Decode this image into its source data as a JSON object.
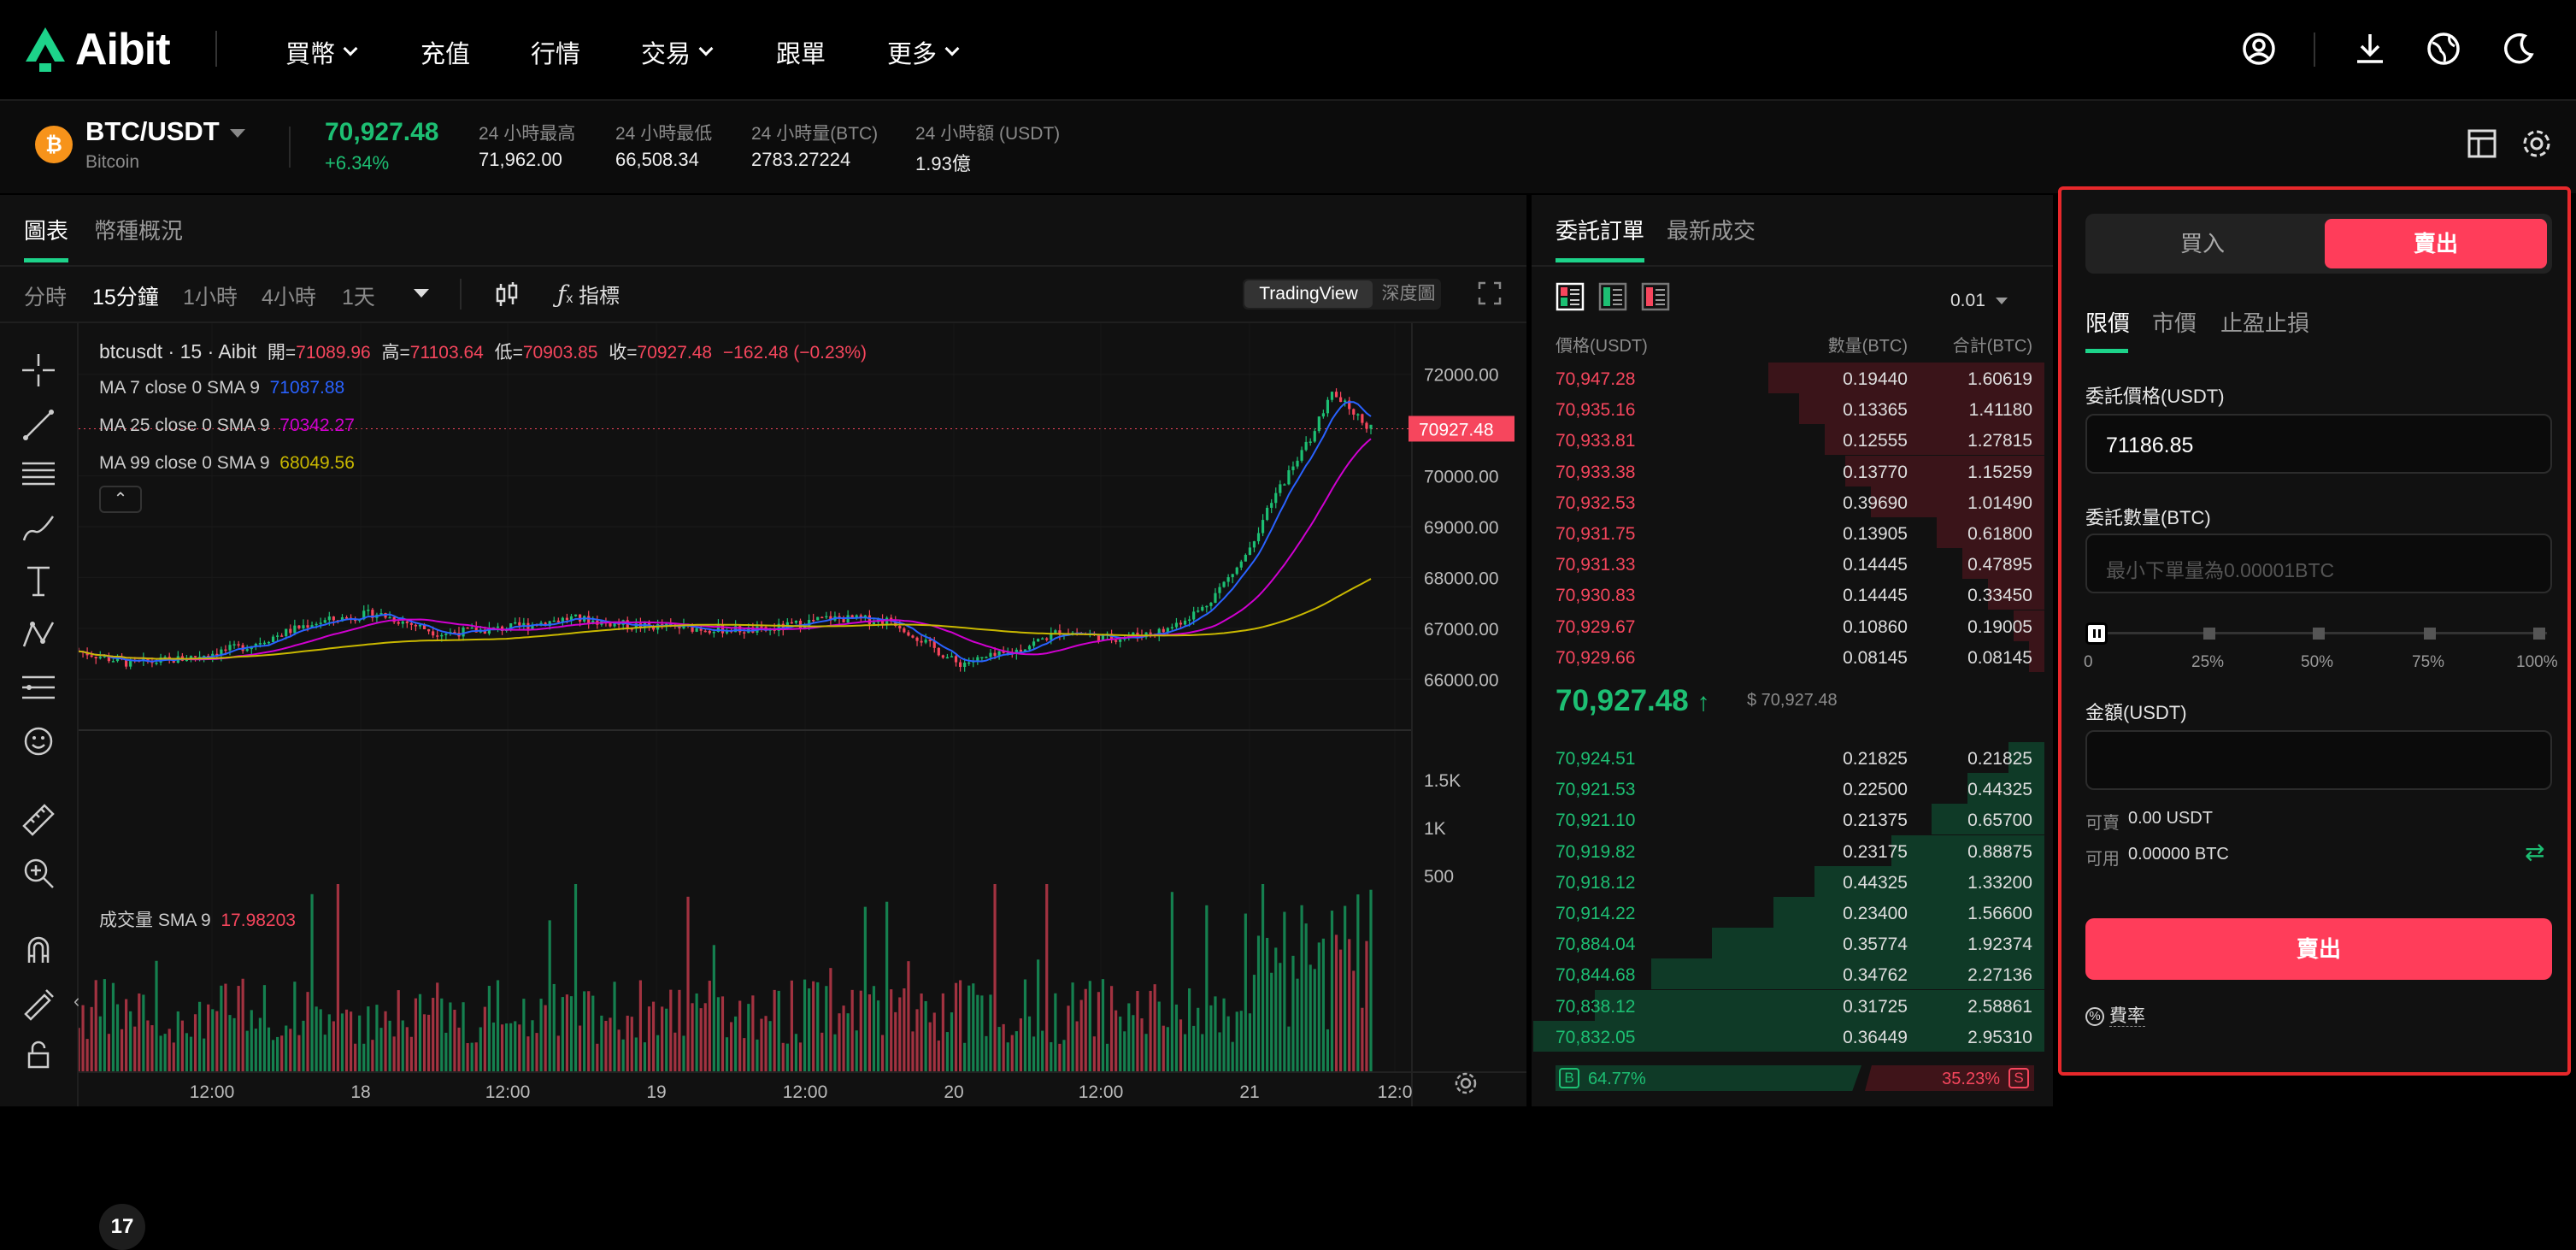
{
  "nav": {
    "logo_text": "Aibit",
    "items": [
      "買幣",
      "充值",
      "行情",
      "交易",
      "跟單",
      "更多"
    ]
  },
  "ticker": {
    "pair": "BTC/USDT",
    "coin_name": "Bitcoin",
    "price": "70,927.48",
    "change": "+6.34%",
    "stats": [
      {
        "label": "24 小時最高",
        "value": "71,962.00"
      },
      {
        "label": "24 小時最低",
        "value": "66,508.34"
      },
      {
        "label": "24 小時量(BTC)",
        "value": "2783.27224"
      },
      {
        "label": "24 小時額 (USDT)",
        "value": "1.93億"
      }
    ]
  },
  "chart_panel": {
    "tabs": [
      "圖表",
      "幣種概況"
    ],
    "intervals": [
      "分時",
      "15分鐘",
      "1小時",
      "4小時",
      "1天"
    ],
    "indicators_label": "指標",
    "view_modes": [
      "TradingView",
      "深度圖"
    ]
  },
  "chart_data": {
    "type": "candlestick",
    "symbol_info": "btcusdt · 15 · Aibit",
    "ohlc": {
      "open_label": "開=",
      "open": "71089.96",
      "high_label": "高=",
      "high": "71103.64",
      "low_label": "低=",
      "low": "70903.85",
      "close_label": "收=",
      "close": "70927.48",
      "change": "−162.48 (−0.23%)"
    },
    "ma_legend": [
      {
        "label": "MA 7 close 0 SMA 9",
        "value": "71087.88",
        "color": "#2962ff"
      },
      {
        "label": "MA 25 close 0 SMA 9",
        "value": "70342.27",
        "color": "#d000d0"
      },
      {
        "label": "MA 99 close 0 SMA 9",
        "value": "68049.56",
        "color": "#c9b800"
      }
    ],
    "y_ticks": [
      "72000.00",
      "71000.00",
      "70000.00",
      "69000.00",
      "68000.00",
      "67000.00",
      "66000.00"
    ],
    "last_price_label": "70927.48",
    "volume_legend": {
      "label": "成交量 SMA 9",
      "value": "17.98203"
    },
    "volume_ticks": [
      "1.5K",
      "1K",
      "500"
    ],
    "x_ticks": [
      "12:00",
      "18",
      "12:00",
      "19",
      "12:00",
      "20",
      "12:00",
      "21",
      "12:0"
    ],
    "price_path_points": [
      [
        66550,
        0.0
      ],
      [
        66300,
        0.04
      ],
      [
        66400,
        0.08
      ],
      [
        66650,
        0.13
      ],
      [
        67100,
        0.18
      ],
      [
        67300,
        0.23
      ],
      [
        66900,
        0.28
      ],
      [
        67000,
        0.33
      ],
      [
        67200,
        0.38
      ],
      [
        67050,
        0.43
      ],
      [
        67000,
        0.48
      ],
      [
        66950,
        0.53
      ],
      [
        67200,
        0.58
      ],
      [
        67150,
        0.63
      ],
      [
        66300,
        0.68
      ],
      [
        66500,
        0.72
      ],
      [
        66950,
        0.76
      ],
      [
        66800,
        0.8
      ],
      [
        66950,
        0.84
      ],
      [
        67400,
        0.87
      ],
      [
        68300,
        0.9
      ],
      [
        69800,
        0.93
      ],
      [
        70600,
        0.95
      ],
      [
        71600,
        0.97
      ],
      [
        71400,
        0.98
      ],
      [
        70927,
        1.0
      ]
    ]
  },
  "orderbook": {
    "tabs": [
      "委託訂單",
      "最新成交"
    ],
    "precision": "0.01",
    "headers": [
      "價格(USDT)",
      "數量(BTC)",
      "合計(BTC)"
    ],
    "asks": [
      [
        "70,947.28",
        "0.19440",
        "1.60619",
        0.54
      ],
      [
        "70,935.16",
        "0.13365",
        "1.41180",
        0.48
      ],
      [
        "70,933.81",
        "0.12555",
        "1.27815",
        0.43
      ],
      [
        "70,933.38",
        "0.13770",
        "1.15259",
        0.39
      ],
      [
        "70,932.53",
        "0.39690",
        "1.01490",
        0.34
      ],
      [
        "70,931.75",
        "0.13905",
        "0.61800",
        0.21
      ],
      [
        "70,931.33",
        "0.14445",
        "0.47895",
        0.16
      ],
      [
        "70,930.83",
        "0.14445",
        "0.33450",
        0.11
      ],
      [
        "70,929.67",
        "0.10860",
        "0.19005",
        0.06
      ],
      [
        "70,929.66",
        "0.08145",
        "0.08145",
        0.03
      ]
    ],
    "mid_price": "70,927.48",
    "mid_usd": "$ 70,927.48",
    "bids": [
      [
        "70,924.51",
        "0.21825",
        "0.21825",
        0.07
      ],
      [
        "70,921.53",
        "0.22500",
        "0.44325",
        0.15
      ],
      [
        "70,921.10",
        "0.21375",
        "0.65700",
        0.22
      ],
      [
        "70,919.82",
        "0.23175",
        "0.88875",
        0.3
      ],
      [
        "70,918.12",
        "0.44325",
        "1.33200",
        0.45
      ],
      [
        "70,914.22",
        "0.23400",
        "1.56600",
        0.53
      ],
      [
        "70,884.04",
        "0.35774",
        "1.92374",
        0.65
      ],
      [
        "70,844.68",
        "0.34762",
        "2.27136",
        0.77
      ],
      [
        "70,838.12",
        "0.31725",
        "2.58861",
        0.88
      ],
      [
        "70,832.05",
        "0.36449",
        "2.95310",
        1.0
      ]
    ],
    "buy_label": "B",
    "buy_ratio": "64.77%",
    "sell_ratio": "35.23%",
    "sell_label": "S"
  },
  "trade": {
    "side_tabs": [
      "買入",
      "賣出"
    ],
    "order_types": [
      "限價",
      "市價",
      "止盈止損"
    ],
    "price_label": "委託價格(USDT)",
    "price_value": "71186.85",
    "qty_label": "委託數量(BTC)",
    "qty_placeholder": "最小下單量為0.00001BTC",
    "slider_marks": [
      "0",
      "25%",
      "50%",
      "75%",
      "100%"
    ],
    "amount_label": "金額(USDT)",
    "avail_sell_label": "可賣",
    "avail_sell_value": "0.00 USDT",
    "avail_use_label": "可用",
    "avail_use_value": "0.00000 BTC",
    "submit_label": "賣出",
    "fee_label": "費率"
  },
  "colors": {
    "up": "#1dbf73",
    "down": "#f6465d",
    "accent": "#ff3d5a",
    "highlight_border": "#e8282b"
  }
}
